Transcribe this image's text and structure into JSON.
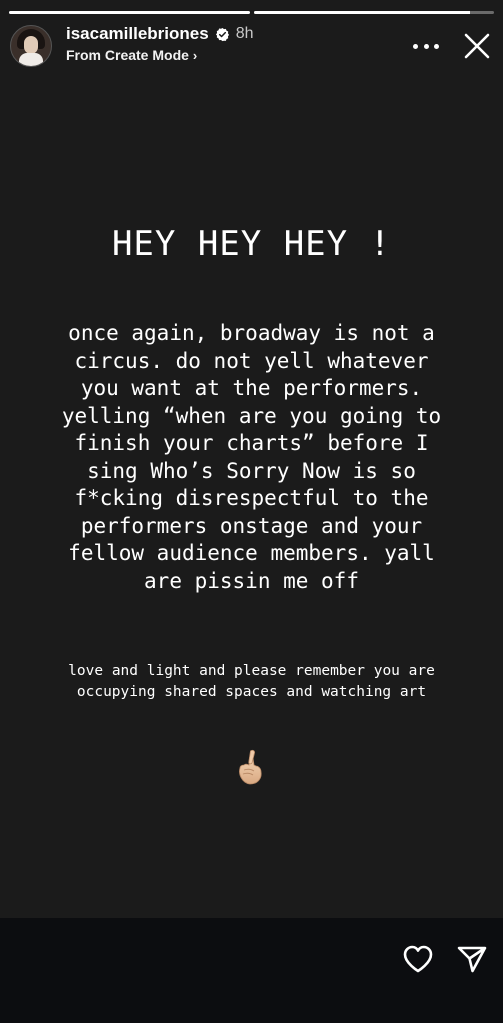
{
  "progress": [
    {
      "fill": 1.0
    },
    {
      "fill": 0.9
    }
  ],
  "header": {
    "username": "isacamillebriones",
    "verified_icon": "verified-badge-icon",
    "time": "8h",
    "subtitle": "From Create Mode",
    "subtitle_chevron": "›",
    "more_icon": "more-horizontal-icon",
    "close_icon": "close-icon"
  },
  "story": {
    "background": "#1b1b1b",
    "headline": "HEY HEY HEY !",
    "body_lines": [
      "once again, broadway is not a",
      "circus. do not yell whatever",
      "you want at the performers.",
      "yelling “when are you going to",
      "finish your charts” before I",
      "sing Who’s Sorry Now is so",
      "f*cking disrespectful to the",
      "performers onstage and your",
      "fellow audience members. yall",
      "are pissin me off"
    ],
    "closing_lines": [
      "love and light and please remember you are",
      "occupying shared spaces and watching art"
    ],
    "emoji": "hand-with-crossed-fingers-emoji"
  },
  "footer": {
    "like_icon": "heart-icon",
    "share_icon": "send-icon"
  }
}
